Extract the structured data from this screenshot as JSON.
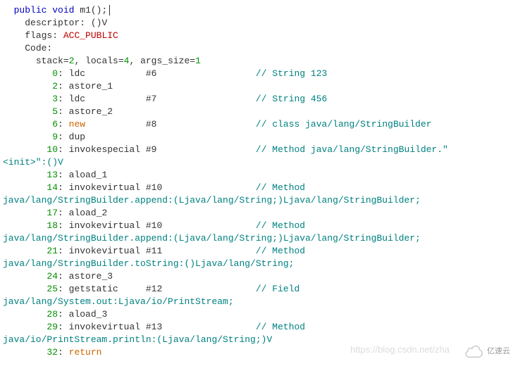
{
  "sig": {
    "public": "public",
    "void": "void",
    "name": "m1();"
  },
  "descriptor_label": "descriptor:",
  "descriptor_value": "()V",
  "flags_label": "flags:",
  "flags_value": "ACC_PUBLIC",
  "code_label": "Code:",
  "stack_line": {
    "stack": "stack=",
    "stack_v": "2",
    "sep1": ", locals=",
    "locals_v": "4",
    "sep2": ", args_size=",
    "args_v": "1"
  },
  "ins": {
    "i0": {
      "ofs": "0",
      "op": "ldc",
      "arg": "#6",
      "cmt": "// String 123"
    },
    "i2": {
      "ofs": "2",
      "op": "astore_1"
    },
    "i3": {
      "ofs": "3",
      "op": "ldc",
      "arg": "#7",
      "cmt": "// String 456"
    },
    "i5": {
      "ofs": "5",
      "op": "astore_2"
    },
    "i6": {
      "ofs": "6",
      "op": "new",
      "arg": "#8",
      "cmt": "// class java/lang/StringBuilder"
    },
    "i9": {
      "ofs": "9",
      "op": "dup"
    },
    "i10": {
      "ofs": "10",
      "op": "invokespecial #9",
      "cmt": "// Method java/lang/StringBuilder.\""
    },
    "i10b": "<init>\":()V",
    "i13": {
      "ofs": "13",
      "op": "aload_1"
    },
    "i14": {
      "ofs": "14",
      "op": "invokevirtual #10",
      "cmt": "// Method "
    },
    "i14b": "java/lang/StringBuilder.append:(Ljava/lang/String;)Ljava/lang/StringBuilder;",
    "i17": {
      "ofs": "17",
      "op": "aload_2"
    },
    "i18": {
      "ofs": "18",
      "op": "invokevirtual #10",
      "cmt": "// Method "
    },
    "i18b": "java/lang/StringBuilder.append:(Ljava/lang/String;)Ljava/lang/StringBuilder;",
    "i21": {
      "ofs": "21",
      "op": "invokevirtual #11",
      "cmt": "// Method "
    },
    "i21b": "java/lang/StringBuilder.toString:()Ljava/lang/String;",
    "i24": {
      "ofs": "24",
      "op": "astore_3"
    },
    "i25": {
      "ofs": "25",
      "op": "getstatic",
      "arg": "#12",
      "cmt": "// Field "
    },
    "i25b": "java/lang/System.out:Ljava/io/PrintStream;",
    "i28": {
      "ofs": "28",
      "op": "aload_3"
    },
    "i29": {
      "ofs": "29",
      "op": "invokevirtual #13",
      "cmt": "// Method "
    },
    "i29b": "java/io/PrintStream.println:(Ljava/lang/String;)V",
    "i32": {
      "ofs": "32",
      "op": "return"
    }
  },
  "watermark": "https://blog.csdn.net/zha",
  "logo_text": "亿速云"
}
